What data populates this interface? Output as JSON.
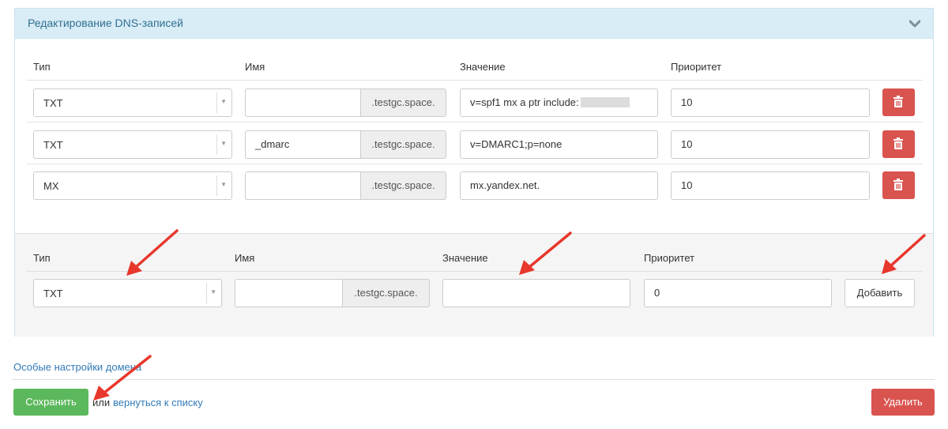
{
  "panel": {
    "title": "Редактирование DNS-записей"
  },
  "columns": {
    "type": "Тип",
    "name": "Имя",
    "value": "Значение",
    "priority": "Приоритет"
  },
  "records": [
    {
      "type": "TXT",
      "name": "",
      "domain_suffix": ".testgc.space.",
      "value": "v=spf1 mx a ptr include:",
      "priority": "10"
    },
    {
      "type": "TXT",
      "name": "_dmarc",
      "domain_suffix": ".testgc.space.",
      "value": "v=DMARC1;p=none",
      "priority": "10"
    },
    {
      "type": "MX",
      "name": "",
      "domain_suffix": ".testgc.space.",
      "value": "mx.yandex.net.",
      "priority": "10"
    }
  ],
  "new_record": {
    "type": "TXT",
    "name": "",
    "domain_suffix": ".testgc.space.",
    "value": "",
    "priority": "0",
    "add_label": "Добавить"
  },
  "footer": {
    "domain_settings_link": "Особые настройки домена",
    "save_label": "Сохранить",
    "or_text": "или",
    "back_link": "вернуться к списку",
    "delete_label": "Удалить"
  },
  "colors": {
    "heading_bg": "#d9edf7",
    "heading_text": "#31708f",
    "danger": "#d9534f",
    "success": "#5cb85c",
    "link": "#337ab7",
    "annotation_arrow": "#e8372c"
  },
  "icons": {
    "collapse": "chevron-down-icon",
    "delete_row": "trash-icon",
    "annotation": "arrow-icon"
  }
}
